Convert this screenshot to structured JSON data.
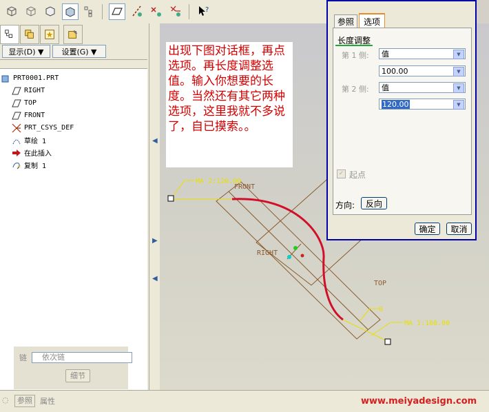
{
  "toolbar": {
    "icons": [
      "cube-wireframe-icon",
      "cube-hidden-line-icon",
      "cube-no-hidden-icon",
      "cube-shaded-icon",
      "tree-toggle-icon",
      "datum-plane-icon",
      "datum-axis-icon",
      "datum-point-icon",
      "coord-sys-icon",
      "help-pointer-icon"
    ]
  },
  "left_panel": {
    "display_menu": "显示(D) ▼",
    "settings_menu": "设置(G) ▼",
    "tree": [
      {
        "label": "PRT0001.PRT",
        "icon": "part-icon"
      },
      {
        "label": "RIGHT",
        "icon": "datum-plane-icon"
      },
      {
        "label": "TOP",
        "icon": "datum-plane-icon"
      },
      {
        "label": "FRONT",
        "icon": "datum-plane-icon"
      },
      {
        "label": "PRT_CSYS_DEF",
        "icon": "coord-sys-icon"
      },
      {
        "label": "草绘 1",
        "icon": "sketch-icon"
      },
      {
        "label": "在此插入",
        "icon": "insert-here-icon"
      },
      {
        "label": "复制 1",
        "icon": "copy-feature-icon"
      }
    ],
    "chain": {
      "label": "链",
      "placeholder": "依次链",
      "details_button": "细节"
    }
  },
  "note": {
    "text": "出现下图对话框，再点选项。再长度调整选值。输入你想要的长度。当然还有其它两种选项，这里我就不多说了，自已摸索。。"
  },
  "graphics": {
    "labels": {
      "side2": "MA 2:120.00",
      "side1": "MA 1:100.00",
      "side1_short": "0",
      "front": "FRONT",
      "right": "RIGHT",
      "top": "TOP"
    },
    "colors": {
      "curve": "#d0102a",
      "datum": "#8b5a2b",
      "dim": "#e8e000"
    }
  },
  "dialog": {
    "tabs": [
      "参照",
      "选项"
    ],
    "active_tab": "选项",
    "section_title": "长度调整",
    "side1_label": "第 1 侧:",
    "side1_type": "值",
    "side1_value": "100.00",
    "side2_label": "第 2 侧:",
    "side2_type": "值",
    "side2_value": "120.00",
    "start_point_label": "起点",
    "direction_label": "方向:",
    "flip_button": "反向",
    "ok_button": "确定",
    "cancel_button": "取消"
  },
  "statusbar": {
    "ref_tab": "参照",
    "props_tab": "属性",
    "watermark": "www.meiyadesign.com"
  }
}
